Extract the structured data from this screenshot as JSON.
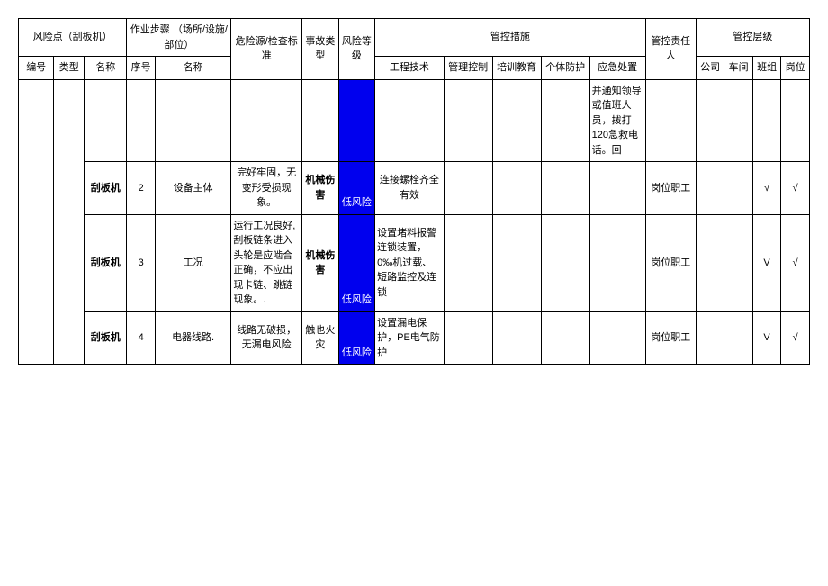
{
  "headers": {
    "risk_point": "风险点（刮板机）",
    "work_steps": "作业步骤\n（场所/设施/部位）",
    "hazard_std": "危险源/检查标准",
    "accident_type": "事故类型",
    "risk_level": "风险等级",
    "control_measures": "管控措施",
    "control_owner": "管控责任人",
    "control_level": "管控层级",
    "sub": {
      "id": "编号",
      "type": "类型",
      "name": "名称",
      "seq": "序号",
      "step_name": "名称",
      "eng": "工程技术",
      "mgmt": "管理控制",
      "edu": "培训教育",
      "ppe": "个体防护",
      "emg": "应急处置",
      "co": "公司",
      "ws": "车间",
      "tm": "班组",
      "ps": "岗位"
    }
  },
  "rows": [
    {
      "name": "",
      "seq": "",
      "step_name": "",
      "hazard": "",
      "accident": "",
      "risk": "",
      "eng": "",
      "mgmt": "",
      "edu": "",
      "ppe": "",
      "emg": "并通知领导或值班人员，拨打120急救电话。回",
      "resp": "",
      "co": "",
      "ws": "",
      "tm": "",
      "ps": ""
    },
    {
      "name": "刮板机",
      "seq": "2",
      "step_name": "设备主体",
      "hazard": "完好牢固，无变形受损现象。",
      "accident": "机械伤害",
      "risk": "低风险",
      "eng": "连接螺栓齐全有效",
      "mgmt": "",
      "edu": "",
      "ppe": "",
      "emg": "",
      "resp": "岗位职工",
      "co": "",
      "ws": "",
      "tm": "√",
      "ps": "√"
    },
    {
      "name": "刮板机",
      "seq": "3",
      "step_name": "工况",
      "hazard": "运行工况良好,刮板链条进入头轮是应啮合正确，不应出现卡链、跳链现象。.",
      "accident": "机械伤害",
      "risk": "低风险",
      "eng": "设置堵料报警连锁装置，0‰机过载、短路监控及连锁",
      "mgmt": "",
      "edu": "",
      "ppe": "",
      "emg": "",
      "resp": "岗位职工",
      "co": "",
      "ws": "",
      "tm": "V",
      "ps": "√"
    },
    {
      "name": "刮板机",
      "seq": "4",
      "step_name": "电器线路.",
      "hazard": "线路无破损，无漏电风险",
      "accident": "触也火灾",
      "risk": "低风险",
      "eng": "设置漏电保护，PE电气防护",
      "mgmt": "",
      "edu": "",
      "ppe": "",
      "emg": "",
      "resp": "岗位职工",
      "co": "",
      "ws": "",
      "tm": "V",
      "ps": "√"
    }
  ]
}
